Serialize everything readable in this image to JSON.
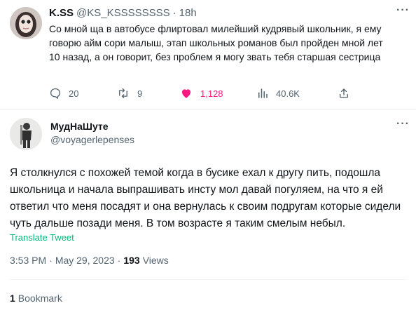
{
  "quoted_tweet": {
    "author_name": "K.SS",
    "author_handle": "@KS_KSSSSSSSS",
    "separator": "·",
    "time": "18h",
    "text": "Со мной ща в автобусе флиртовал милейший кудрявый школьник, я ему говорю айм сори малыш, этап школьных романов был пройден мной лет 10 назад, а он говорит, без проблем я могу звать тебя старшая сестрица",
    "actions": {
      "replies": "20",
      "retweets": "9",
      "likes": "1,128",
      "views": "40.6K"
    },
    "icons": [
      "reply-icon",
      "retweet-icon",
      "heart-icon",
      "views-icon",
      "share-icon"
    ],
    "like_color": "#f91880"
  },
  "main_tweet": {
    "author_name": "МудНаШуте",
    "author_handle": "@voyagerlepenses",
    "text": "Я столкнулся с похожей темой когда в бусике ехал к другу пить, подошла школьница и начала выпрашивать инсту мол давай погуляем, на что я ей ответил что меня посадят и она вернулась к своим подругам которые сидели чуть дальше позади меня. В том возрасте я таким смелым небыл.",
    "translate_label": "Translate Tweet",
    "translate_color": "#00ba7c",
    "time": "3:53 PM",
    "date": "May 29, 2023",
    "dot": "·",
    "views_count": "193",
    "views_label": "Views",
    "bookmark_count": "1",
    "bookmark_label": "Bookmark"
  }
}
